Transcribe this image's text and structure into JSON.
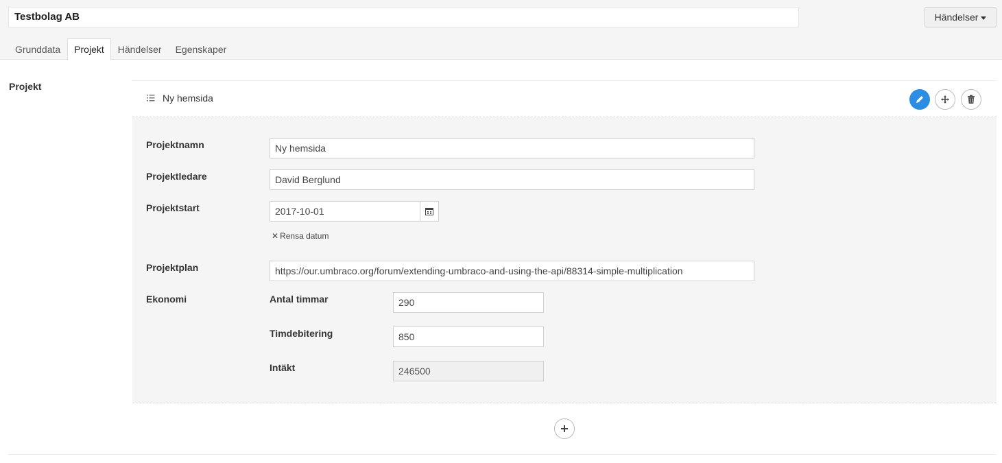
{
  "header": {
    "name_value": "Testbolag AB",
    "actions_label": "Händelser"
  },
  "tabs": [
    {
      "label": "Grunddata",
      "active": false
    },
    {
      "label": "Projekt",
      "active": true
    },
    {
      "label": "Händelser",
      "active": false
    },
    {
      "label": "Egenskaper",
      "active": false
    }
  ],
  "section": {
    "label": "Projekt"
  },
  "item": {
    "title": "Ny hemsida",
    "icons": {
      "list": "list-icon",
      "edit": "pencil-icon",
      "move": "move-icon",
      "delete": "trash-icon"
    }
  },
  "form": {
    "projektnamn": {
      "label": "Projektnamn",
      "value": "Ny hemsida"
    },
    "projektledare": {
      "label": "Projektledare",
      "value": "David Berglund"
    },
    "projektstart": {
      "label": "Projektstart",
      "value": "2017-10-01",
      "clear_label": "Rensa datum"
    },
    "projektplan": {
      "label": "Projektplan",
      "value": "https://our.umbraco.org/forum/extending-umbraco-and-using-the-api/88314-simple-multiplication"
    },
    "ekonomi": {
      "label": "Ekonomi",
      "antal_timmar": {
        "label": "Antal timmar",
        "value": "290"
      },
      "timdebitering": {
        "label": "Timdebitering",
        "value": "850"
      },
      "intakt": {
        "label": "Intäkt",
        "value": "246500"
      }
    }
  },
  "colors": {
    "accent": "#2b8de4",
    "panel_bg": "#f5f5f5"
  }
}
